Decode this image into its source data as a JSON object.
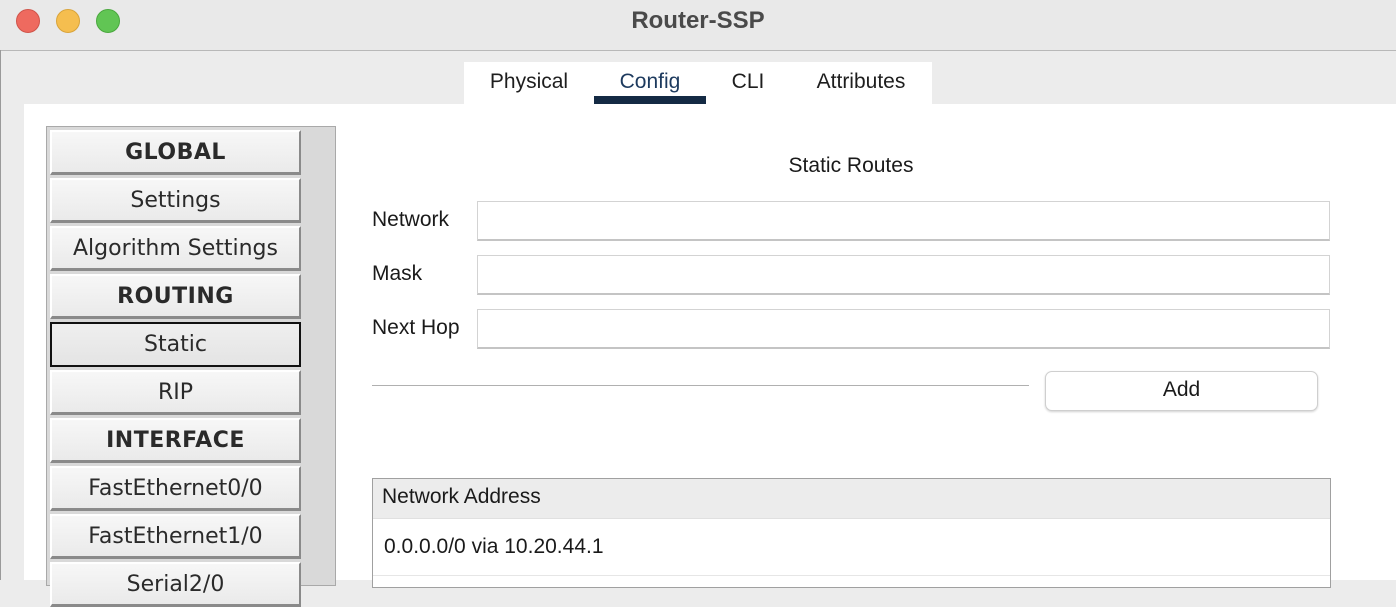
{
  "window": {
    "title": "Router-SSP",
    "buttons": [
      "close",
      "minimize",
      "zoom"
    ]
  },
  "tabs": [
    {
      "label": "Physical",
      "active": false
    },
    {
      "label": "Config",
      "active": true
    },
    {
      "label": "CLI",
      "active": false
    },
    {
      "label": "Attributes",
      "active": false
    }
  ],
  "sidebar": {
    "items": [
      {
        "label": "GLOBAL",
        "type": "header"
      },
      {
        "label": "Settings",
        "type": "item"
      },
      {
        "label": "Algorithm Settings",
        "type": "item"
      },
      {
        "label": "ROUTING",
        "type": "header"
      },
      {
        "label": "Static",
        "type": "item",
        "active": true
      },
      {
        "label": "RIP",
        "type": "item"
      },
      {
        "label": "INTERFACE",
        "type": "header"
      },
      {
        "label": "FastEthernet0/0",
        "type": "item"
      },
      {
        "label": "FastEthernet1/0",
        "type": "item"
      },
      {
        "label": "Serial2/0",
        "type": "item"
      }
    ]
  },
  "static_routes": {
    "title": "Static Routes",
    "fields": {
      "network": {
        "label": "Network",
        "value": ""
      },
      "mask": {
        "label": "Mask",
        "value": ""
      },
      "next_hop": {
        "label": "Next Hop",
        "value": ""
      }
    },
    "add_label": "Add",
    "table": {
      "header": "Network Address",
      "rows": [
        "0.0.0.0/0 via 10.20.44.1"
      ]
    }
  }
}
